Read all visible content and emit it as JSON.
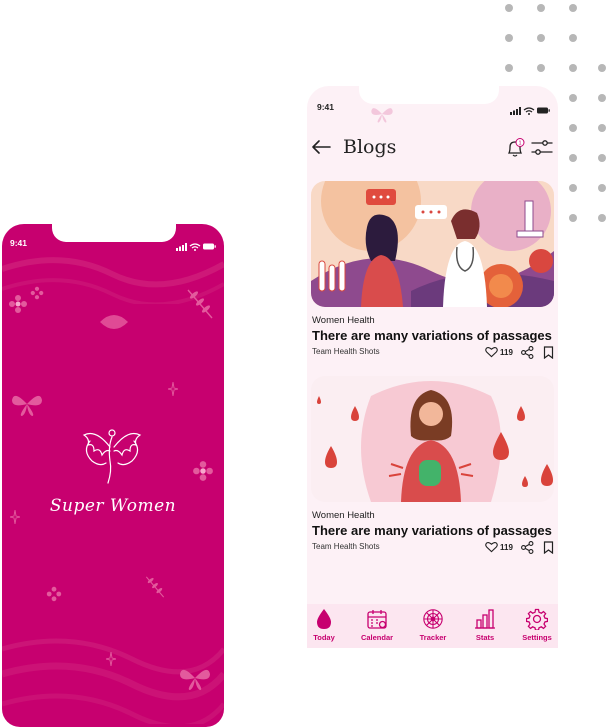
{
  "colors": {
    "brand": "#c7006f",
    "card_bg": "#fdf1f6"
  },
  "splash": {
    "time": "9:41",
    "brand_name": "Super Women"
  },
  "blogs": {
    "time": "9:41",
    "page_title": "Blogs",
    "notification_count": "1",
    "posts": [
      {
        "category": "Women Health",
        "title": "There are many variations of passages",
        "author": "Team Health Shots",
        "likes": "119",
        "image": "woman-doctor-consultation-illustration"
      },
      {
        "category": "Women Health",
        "title": "There are many variations of passages",
        "author": "Team Health Shots",
        "likes": "119",
        "image": "woman-period-cramps-illustration"
      }
    ],
    "tabs": [
      {
        "label": "Today",
        "icon": "drop-icon"
      },
      {
        "label": "Calendar",
        "icon": "calendar-icon"
      },
      {
        "label": "Tracker",
        "icon": "tracker-icon"
      },
      {
        "label": "Stats",
        "icon": "stats-icon"
      },
      {
        "label": "Settings",
        "icon": "gear-icon"
      }
    ]
  }
}
